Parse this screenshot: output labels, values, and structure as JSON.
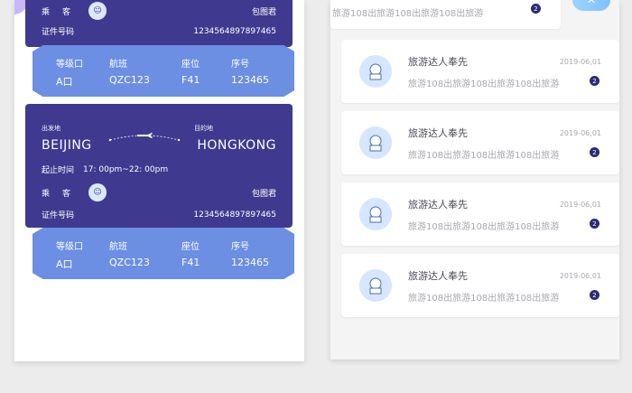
{
  "ticket_top": {
    "passenger_label": "乘客",
    "passenger_name": "包图君",
    "id_label": "证件号码",
    "id_value": "1234564897897465"
  },
  "seat_top": {
    "headers": [
      "等级口",
      "航班",
      "座位",
      "序号"
    ],
    "values": [
      "A口",
      "QZC123",
      "F41",
      "123465"
    ]
  },
  "ticket_main": {
    "from_label": "出发地",
    "to_label": "目的地",
    "from_city": "BEIJING",
    "to_city": "HONGKONG",
    "time_label": "起止时间",
    "time_value": "17: 00pm~22: 00pm",
    "passenger_label": "乘客",
    "passenger_name": "包图君",
    "id_label": "证件号码",
    "id_value": "1234564897897465"
  },
  "seat_main": {
    "headers": [
      "等级口",
      "航班",
      "座位",
      "序号"
    ],
    "values": [
      "A口",
      "QZC123",
      "F41",
      "123465"
    ]
  },
  "messages": {
    "top_preview": {
      "text": "旅游108出旅游108出旅游108出旅游",
      "badge": "2"
    },
    "items": [
      {
        "name": "旅游达人奉先",
        "text": "旅游108出旅游108出旅游108出旅游",
        "date": "2019-06,01",
        "badge": "2"
      },
      {
        "name": "旅游达人奉先",
        "text": "旅游108出旅游108出旅游108出旅游",
        "date": "2019-06,01",
        "badge": "2"
      },
      {
        "name": "旅游达人奉先",
        "text": "旅游108出旅游108出旅游108出旅游",
        "date": "2019-06,01",
        "badge": "2"
      },
      {
        "name": "旅游达人奉先",
        "text": "旅游108出旅游108出旅游108出旅游",
        "date": "2019-06,01",
        "badge": "2"
      }
    ]
  },
  "colors": {
    "ticket": "#3f3a8f",
    "band": "#6c8fe3",
    "badge": "#2e2a78"
  }
}
